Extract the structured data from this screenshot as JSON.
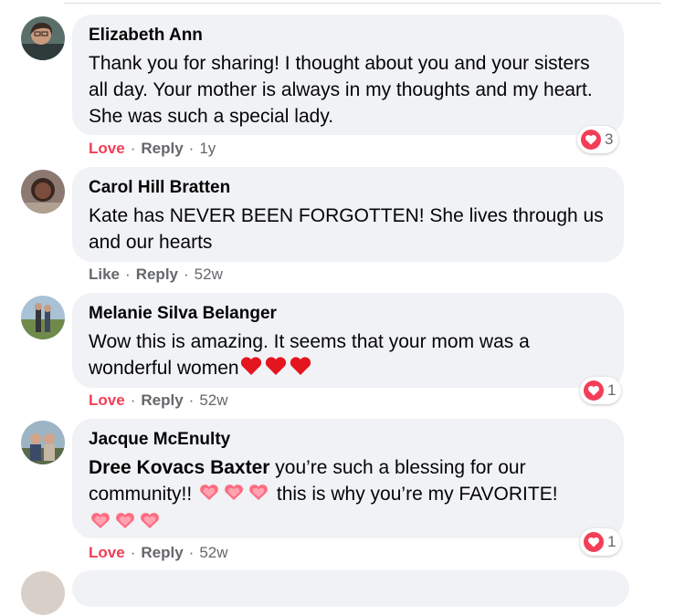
{
  "comments": [
    {
      "author": "Elizabeth Ann",
      "text": "Thank you for sharing! I thought about you and your sisters all day. Your mother is always in my thoughts and my heart. She was such a special lady.",
      "action": "Love",
      "reply": "Reply",
      "time": "1y",
      "reaction_icon": "heart-icon",
      "reaction_count": "3"
    },
    {
      "author": "Carol Hill Bratten",
      "text": "Kate has NEVER BEEN FORGOTTEN! She lives through us and our hearts",
      "action": "Like",
      "reply": "Reply",
      "time": "52w"
    },
    {
      "author": "Melanie Silva Belanger",
      "text": "Wow this is amazing. It seems that your mom was a wonderful women",
      "action": "Love",
      "reply": "Reply",
      "time": "52w",
      "reaction_icon": "heart-icon",
      "reaction_count": "1"
    },
    {
      "author": "Jacque McEnulty",
      "mention": "Dree Kovacs Baxter",
      "text_part1": " you’re such a blessing for our community!! ",
      "text_part2": " this is why you’re my FAVORITE!",
      "action": "Love",
      "reply": "Reply",
      "time": "52w",
      "reaction_icon": "heart-icon",
      "reaction_count": "1"
    }
  ],
  "separator": "·",
  "colors": {
    "bubble": "#f0f2f5",
    "love": "#f33e58",
    "meta": "#65676b",
    "text": "#050505"
  }
}
